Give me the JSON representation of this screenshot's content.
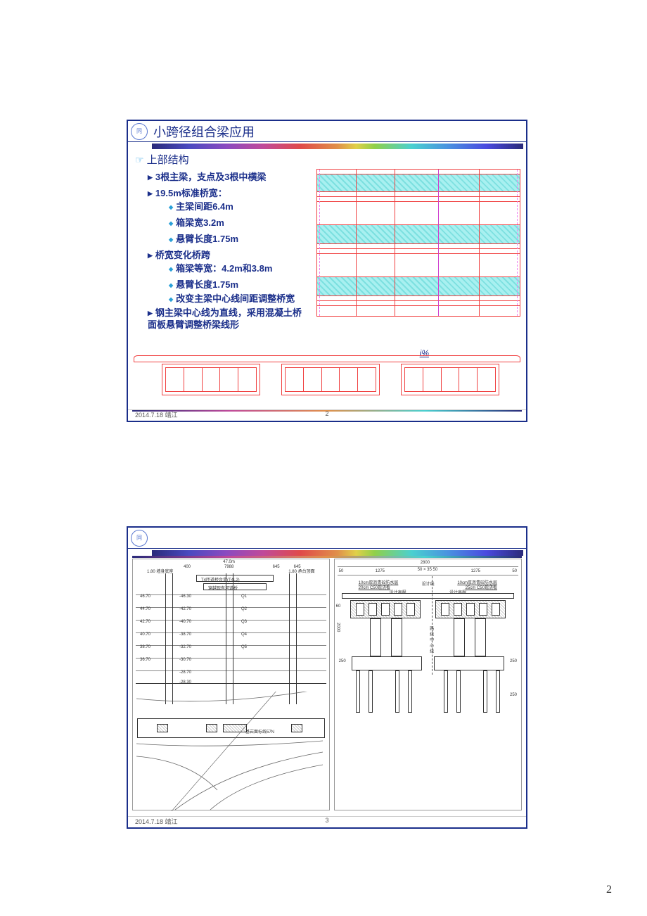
{
  "page_number_corner": "2",
  "slide1": {
    "title": "小跨径组合梁应用",
    "section": "上部结构",
    "items": [
      {
        "text": "3根主梁，支点及3根中横梁"
      },
      {
        "text": "19.5m标准桥宽：",
        "subs": [
          "主梁间距6.4m",
          "箱梁宽3.2m",
          "悬臂长度1.75m"
        ]
      },
      {
        "text": "桥宽变化桥跨",
        "subs": [
          "箱梁等宽：4.2m和3.8m",
          "悬臂长度1.75m",
          "改变主梁中心线间距调整桥宽"
        ]
      },
      {
        "text": "钢主梁中心线为直线，采用混凝土桥面板悬臂调整桥梁线形"
      }
    ],
    "slope_label": "i%",
    "footer_date": "2014.7.18 靖江",
    "page": "2"
  },
  "slide2": {
    "right_dims": {
      "total": "2800",
      "edge_l": "50",
      "span_l": "1275",
      "gap_mid": "50 × 35 50",
      "span_r": "1275",
      "edge_r": "50",
      "height": "2000",
      "h1": "60",
      "cap_h": "250",
      "pile_len": "250",
      "note_l": "10cm厚沥青砼防水层",
      "note_l2": "20cm C50现浇板",
      "note_r": "10cm厚沥青砼防水层",
      "note_r2": "25cm C50现浇板",
      "label_l": "设计高程",
      "label_c": "设计线",
      "label_r": "设计高程",
      "centerline": "路线中心线"
    },
    "left_labels": {
      "title_top": "47.0m",
      "box1": "T4匝道桥台背(T4L2)",
      "box2": "穿越现有河道桥",
      "row_lbls": [
        "1.80 墙身底座",
        "1.80 承台顶面"
      ],
      "elev": [
        "46.70",
        "44.70",
        "42.70",
        "40.70",
        "38.70",
        "36.70"
      ],
      "elev2": [
        "-46.30",
        "-42.70",
        "-40.70",
        "-38.70",
        "-32.70",
        "-30.70",
        "-28.70",
        "-28.30"
      ],
      "dim_grid": [
        "400",
        "7988",
        "645",
        "645"
      ],
      "bottom_note": "基岩面标线57N",
      "soil": [
        "Q1",
        "Q2",
        "Q3",
        "Q4",
        "Q5"
      ]
    },
    "footer_date": "2014.7.18 靖江",
    "page": "3"
  }
}
